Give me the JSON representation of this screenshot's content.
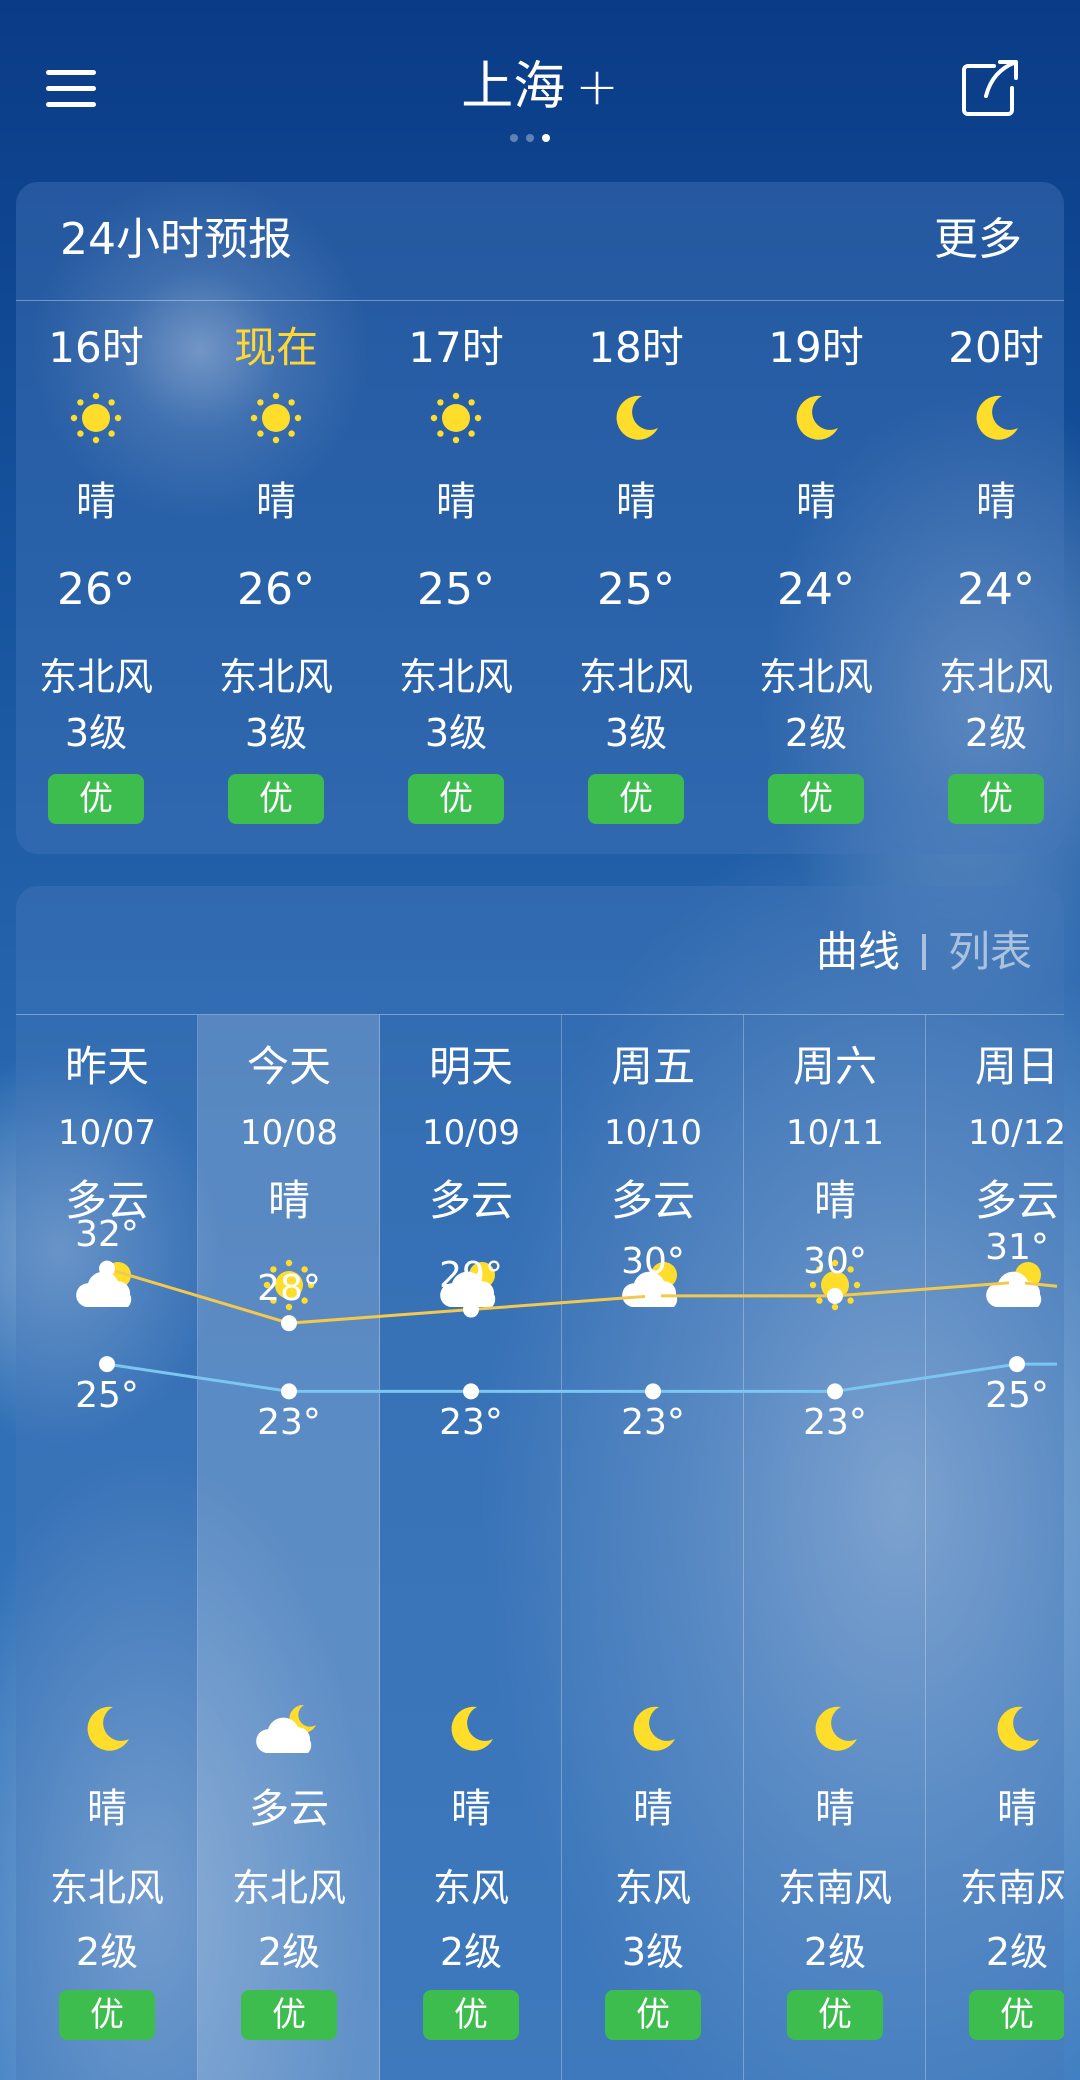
{
  "header": {
    "city": "上海",
    "add_symbol": "+",
    "page_dots": 3,
    "active_dot": 2
  },
  "hourly": {
    "title": "24小时预报",
    "more_label": "更多",
    "items": [
      {
        "time": "16时",
        "icon": "sun-icon",
        "cond": "晴",
        "temp": "26°",
        "wind": "东北风",
        "level": "3级",
        "aqi": "优"
      },
      {
        "time": "现在",
        "icon": "sun-icon",
        "cond": "晴",
        "temp": "26°",
        "wind": "东北风",
        "level": "3级",
        "aqi": "优",
        "now": true
      },
      {
        "time": "17时",
        "icon": "sun-icon",
        "cond": "晴",
        "temp": "25°",
        "wind": "东北风",
        "level": "3级",
        "aqi": "优"
      },
      {
        "time": "18时",
        "icon": "moon-icon",
        "cond": "晴",
        "temp": "25°",
        "wind": "东北风",
        "level": "3级",
        "aqi": "优"
      },
      {
        "time": "19时",
        "icon": "moon-icon",
        "cond": "晴",
        "temp": "24°",
        "wind": "东北风",
        "level": "2级",
        "aqi": "优"
      },
      {
        "time": "20时",
        "icon": "moon-icon",
        "cond": "晴",
        "temp": "24°",
        "wind": "东北风",
        "level": "2级",
        "aqi": "优"
      }
    ]
  },
  "daily": {
    "view_curve": "曲线",
    "view_list": "列表",
    "items": [
      {
        "name": "昨天",
        "date": "10/07",
        "day_cond": "多云",
        "day_icon": "cloud-sun-icon",
        "high": 32,
        "low": 25,
        "night_icon": "moon-icon",
        "night_cond": "晴",
        "wind": "东北风",
        "level": "2级",
        "aqi": "优"
      },
      {
        "name": "今天",
        "date": "10/08",
        "day_cond": "晴",
        "day_icon": "sun-icon",
        "high": 28,
        "low": 23,
        "night_icon": "cloud-moon-icon",
        "night_cond": "多云",
        "wind": "东北风",
        "level": "2级",
        "aqi": "优",
        "today": true
      },
      {
        "name": "明天",
        "date": "10/09",
        "day_cond": "多云",
        "day_icon": "cloud-sun-icon",
        "high": 29,
        "low": 23,
        "night_icon": "moon-icon",
        "night_cond": "晴",
        "wind": "东风",
        "level": "2级",
        "aqi": "优"
      },
      {
        "name": "周五",
        "date": "10/10",
        "day_cond": "多云",
        "day_icon": "cloud-sun-icon",
        "high": 30,
        "low": 23,
        "night_icon": "moon-icon",
        "night_cond": "晴",
        "wind": "东风",
        "level": "3级",
        "aqi": "优"
      },
      {
        "name": "周六",
        "date": "10/11",
        "day_cond": "晴",
        "day_icon": "sun-icon",
        "high": 30,
        "low": 23,
        "night_icon": "moon-icon",
        "night_cond": "晴",
        "wind": "东南风",
        "level": "2级",
        "aqi": "优"
      },
      {
        "name": "周日",
        "date": "10/12",
        "day_cond": "多云",
        "day_icon": "cloud-sun-icon",
        "high": 31,
        "low": 25,
        "night_icon": "moon-icon",
        "night_cond": "晴",
        "wind": "东南风",
        "level": "2级",
        "aqi": "优"
      }
    ]
  },
  "colors": {
    "high_line": "#f2c94c",
    "low_line": "#7cc6f2",
    "now_text": "#ffd633",
    "aqi_good": "#3cbd4d",
    "icon_yellow": "#ffdd2b"
  }
}
